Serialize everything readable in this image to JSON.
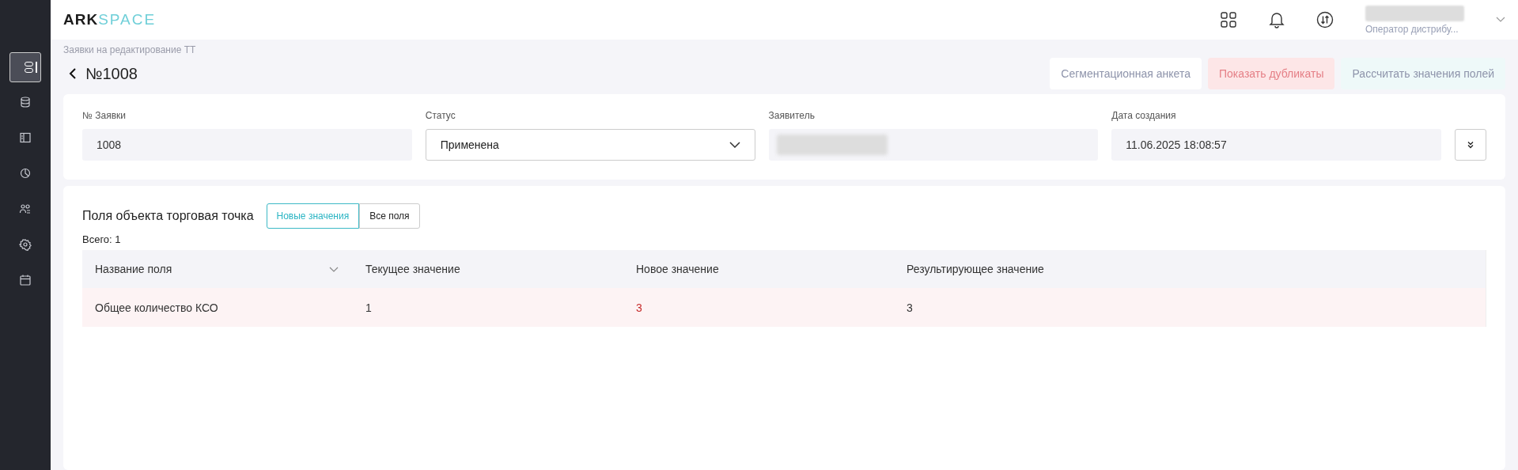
{
  "sidebar": {
    "items": [
      {
        "selected": true
      },
      {
        "selected": false
      },
      {
        "selected": false
      },
      {
        "selected": false
      },
      {
        "selected": false
      },
      {
        "selected": false
      },
      {
        "selected": false
      }
    ]
  },
  "header": {
    "logo": {
      "part_1": "ARK",
      "part_2": "SPACE"
    },
    "user": {
      "role": "Оператор дистрибу..."
    }
  },
  "breadcrumb": "Заявки на редактирование ТТ",
  "title": "№1008",
  "actions": [
    {
      "label": "Сегментационная анкета",
      "kind": "neutral",
      "disabled": false
    },
    {
      "label": "Показать дубликаты",
      "kind": "danger",
      "disabled": true
    },
    {
      "label": "Рассчитать значения полей",
      "kind": "accent",
      "disabled": true
    }
  ],
  "details": [
    {
      "label": "№ Заявки",
      "kind": "readonly",
      "value": "1008"
    },
    {
      "label": "Статус",
      "kind": "select",
      "value": "Применена"
    },
    {
      "label": "Заявитель",
      "kind": "hidden"
    },
    {
      "label": "Дата создания",
      "kind": "readonly",
      "value": "11.06.2025 18:08:57"
    }
  ],
  "fields_section": {
    "title": "Поля объекта торговая точка",
    "filters": [
      {
        "label": "Новые значения",
        "selected": true
      },
      {
        "label": "Все поля",
        "selected": false
      }
    ],
    "total": "Всего: 1",
    "table": {
      "columns": [
        "Название поля",
        "Текущее значение",
        "Новое значение",
        "Результирующее значение"
      ],
      "rows": [
        {
          "changed": true,
          "cells": [
            "Общее количество КСО",
            "1",
            "3",
            "3"
          ]
        }
      ]
    }
  }
}
